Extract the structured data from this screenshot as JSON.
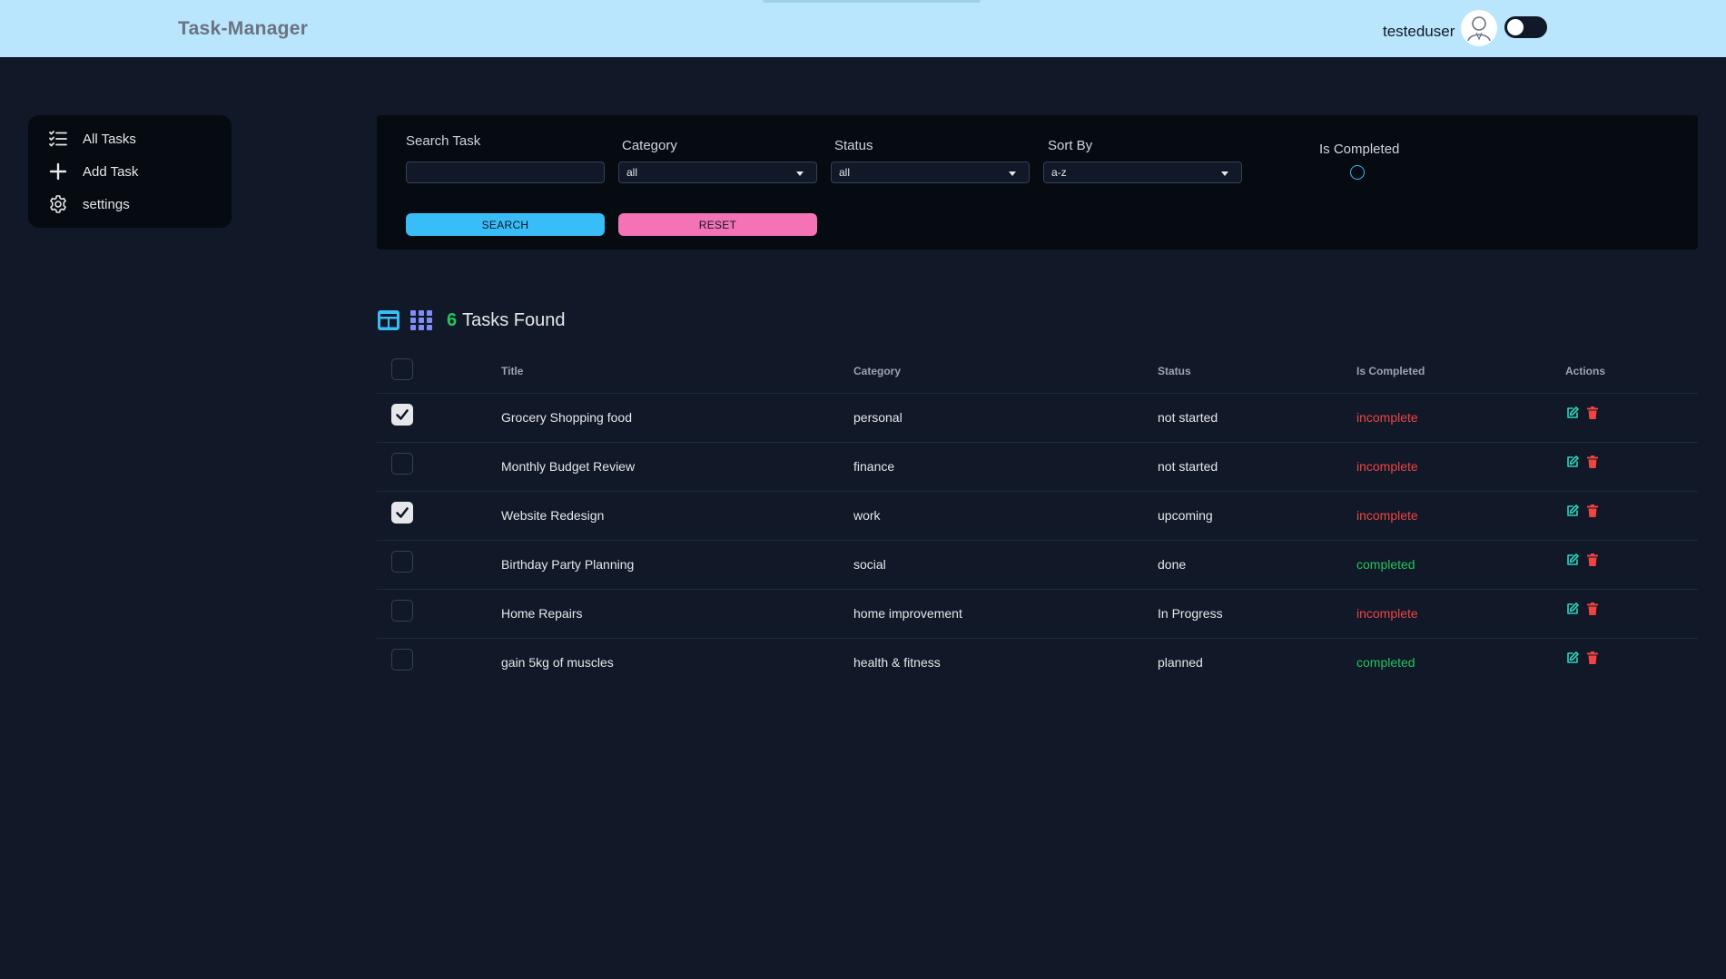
{
  "header": {
    "brand": "Task-Manager",
    "username": "testeduser"
  },
  "sidebar": {
    "items": [
      {
        "label": "All Tasks",
        "icon": "list-check-icon"
      },
      {
        "label": "Add Task",
        "icon": "plus-icon"
      },
      {
        "label": "settings",
        "icon": "gear-icon"
      }
    ]
  },
  "filters": {
    "search_label": "Search Task",
    "search_value": "",
    "category_label": "Category",
    "category_value": "all",
    "status_label": "Status",
    "status_value": "all",
    "sort_label": "Sort By",
    "sort_value": "a-z",
    "completed_label": "Is Completed",
    "search_button": "SEARCH",
    "reset_button": "RESET"
  },
  "summary": {
    "count": "6",
    "text": "Tasks Found"
  },
  "table": {
    "columns": [
      "Title",
      "Category",
      "Status",
      "Is Completed",
      "Actions"
    ],
    "rows": [
      {
        "title": "Grocery Shopping food",
        "category": "personal",
        "status": "not started",
        "completed": "incomplete",
        "checked": true
      },
      {
        "title": "Monthly Budget Review",
        "category": "finance",
        "status": "not started",
        "completed": "incomplete",
        "checked": false
      },
      {
        "title": "Website Redesign",
        "category": "work",
        "status": "upcoming",
        "completed": "incomplete",
        "checked": true
      },
      {
        "title": "Birthday Party Planning",
        "category": "social",
        "status": "done",
        "completed": "completed",
        "checked": false
      },
      {
        "title": "Home Repairs",
        "category": "home improvement",
        "status": "In Progress",
        "completed": "incomplete",
        "checked": false
      },
      {
        "title": "gain 5kg of muscles",
        "category": "health & fitness",
        "status": "planned",
        "completed": "completed",
        "checked": false
      }
    ]
  },
  "colors": {
    "accent": "#38bdf8",
    "reset": "#f472b6",
    "count": "#22c55e",
    "incomplete": "#ef4444",
    "completed": "#22c55e",
    "edit": "#2dd4bf",
    "delete": "#ef4444"
  }
}
